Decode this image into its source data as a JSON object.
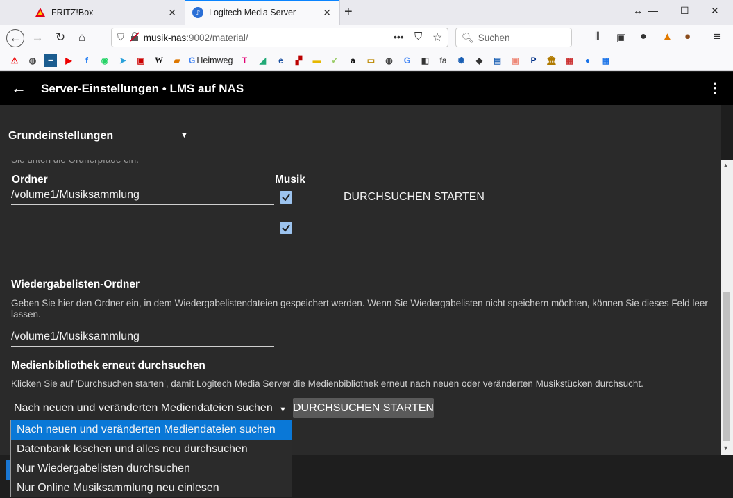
{
  "browser": {
    "tabs": [
      {
        "title": "FRITZ!Box",
        "active": false
      },
      {
        "title": "Logitech Media Server",
        "active": true
      }
    ],
    "url_host": "musik-nas",
    "url_rest": ":9002/material/",
    "search_placeholder": "Suchen",
    "bookmark_heimweg": "Heimweg",
    "bookmark_w": "W",
    "bookmark_g": "G",
    "bookmark_fa": "fa"
  },
  "app": {
    "title": "Server-Einstellungen • LMS auf NAS",
    "section_select": "Grundeinstellungen",
    "hint_cut": "Sie unten die Ordnerpfade ein.",
    "folders": {
      "col_folder": "Ordner",
      "col_music": "Musik",
      "rows": [
        {
          "path": "/volume1/Musiksammlung",
          "music": true
        },
        {
          "path": "",
          "music": true
        }
      ],
      "scan_label": "DURCHSUCHEN STARTEN"
    },
    "playlist": {
      "heading": "Wiedergabelisten-Ordner",
      "description": "Geben Sie hier den Ordner ein, in dem Wiedergabelistendateien gespeichert werden. Wenn Sie Wiedergabelisten nicht speichern möchten, können Sie dieses Feld leer lassen.",
      "value": "/volume1/Musiksammlung"
    },
    "rescan": {
      "heading": "Medienbibliothek erneut durchsuchen",
      "description": "Klicken Sie auf 'Durchsuchen starten', damit Logitech Media Server die Medienbibliothek erneut nach neuen oder veränderten Musikstücken durchsucht.",
      "selected": "Nach neuen und veränderten Mediendateien suchen",
      "button": "DURCHSUCHEN STARTEN",
      "options": [
        "Nach neuen und veränderten Mediendateien suchen",
        "Datenbank löschen und alles neu durchsuchen",
        "Nur Wiedergabelisten durchsuchen",
        "Nur Online Musiksammlung neu einlesen"
      ]
    }
  },
  "colors": {
    "accent": "#0a84ff",
    "selected_option": "#0a78d7",
    "checkbox": "#9cc3ee"
  }
}
